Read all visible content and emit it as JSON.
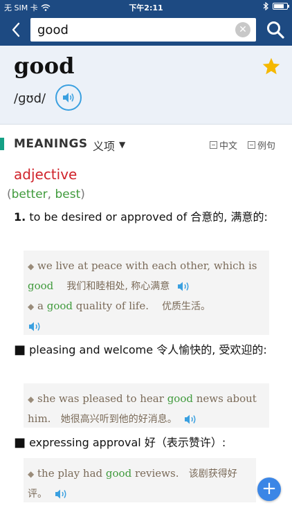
{
  "statusbar": {
    "carrier": "无 SIM 卡",
    "time": "下午2:11"
  },
  "search": {
    "value": "good"
  },
  "entry": {
    "headword": "good",
    "phonetic": "/ɡʊd/"
  },
  "meanings_header": {
    "title": "MEANINGS",
    "title_cn": "义项",
    "toggle_cn": "中文",
    "toggle_examples": "例句"
  },
  "part_of_speech": "adjective",
  "forms": {
    "comparative": "better",
    "superlative": "best"
  },
  "senses": [
    {
      "marker": "1.",
      "definition": "to be desired or approved of",
      "definition_cn": "合意的, 满意的:",
      "examples": [
        {
          "pre": "we live at peace with each other, which is ",
          "highlight": "good",
          "post": "",
          "cn": "我们和睦相处, 称心满意"
        },
        {
          "pre": "a ",
          "highlight": "good",
          "post": " quality of life.",
          "cn": "优质生活。"
        }
      ]
    },
    {
      "marker": "■",
      "definition": "pleasing and welcome",
      "definition_cn": "令人愉快的, 受欢迎的:",
      "examples": [
        {
          "pre": "she was pleased to hear ",
          "highlight": "good",
          "post": " news about him.",
          "cn": "她很高兴听到他的好消息。"
        }
      ]
    },
    {
      "marker": "■",
      "definition": "expressing approval",
      "definition_cn": "好（表示赞许）:",
      "examples": [
        {
          "pre": "the play had ",
          "highlight": "good",
          "post": " reviews.",
          "cn": "该剧获得好评。"
        }
      ]
    }
  ],
  "colors": {
    "navbar": "#1d4a82",
    "pos": "#d0232b",
    "highlight": "#3f9a3b",
    "accent": "#14a085",
    "speaker": "#3aa0e0",
    "star": "#f5b800",
    "fab": "#3b86e6"
  }
}
